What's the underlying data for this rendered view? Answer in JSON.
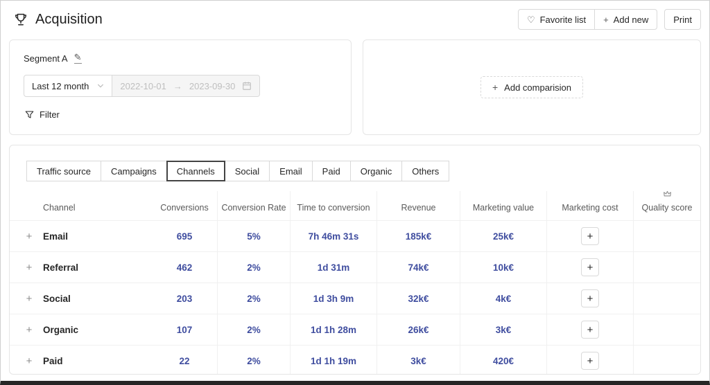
{
  "header": {
    "title": "Acquisition",
    "favorite_button": "Favorite list",
    "add_new_button": "Add new",
    "print_button": "Print"
  },
  "segment": {
    "name": "Segment A",
    "range_label": "Last 12 month",
    "date_start": "2022-10-01",
    "date_separator": "→",
    "date_end": "2023-09-30",
    "filter_label": "Filter"
  },
  "comparison": {
    "add_label": "Add comparision"
  },
  "icons": {
    "heart": "♡",
    "plus": "+",
    "edit": "✎",
    "expand_plus": "+"
  },
  "tabs": [
    {
      "label": "Traffic source",
      "active": false
    },
    {
      "label": "Campaigns",
      "active": false
    },
    {
      "label": "Channels",
      "active": true
    },
    {
      "label": "Social",
      "active": false
    },
    {
      "label": "Email",
      "active": false
    },
    {
      "label": "Paid",
      "active": false
    },
    {
      "label": "Organic",
      "active": false
    },
    {
      "label": "Others",
      "active": false
    }
  ],
  "table": {
    "columns": [
      "Channel",
      "Conversions",
      "Conversion Rate",
      "Time to conversion",
      "Revenue",
      "Marketing value",
      "Marketing cost",
      "Quality score"
    ],
    "rows": [
      {
        "channel": "Email",
        "conversions": "695",
        "conversion_rate": "5%",
        "time_to_conversion": "7h 46m 31s",
        "revenue": "185k€",
        "marketing_value": "25k€"
      },
      {
        "channel": "Referral",
        "conversions": "462",
        "conversion_rate": "2%",
        "time_to_conversion": "1d 31m",
        "revenue": "74k€",
        "marketing_value": "10k€"
      },
      {
        "channel": "Social",
        "conversions": "203",
        "conversion_rate": "2%",
        "time_to_conversion": "1d 3h 9m",
        "revenue": "32k€",
        "marketing_value": "4k€"
      },
      {
        "channel": "Organic",
        "conversions": "107",
        "conversion_rate": "2%",
        "time_to_conversion": "1d 1h 28m",
        "revenue": "26k€",
        "marketing_value": "3k€"
      },
      {
        "channel": "Paid",
        "conversions": "22",
        "conversion_rate": "2%",
        "time_to_conversion": "1d 1h 19m",
        "revenue": "3k€",
        "marketing_value": "420€"
      }
    ]
  },
  "colors": {
    "accent": "#3f4d9f",
    "tab_active_border": "#434343"
  }
}
